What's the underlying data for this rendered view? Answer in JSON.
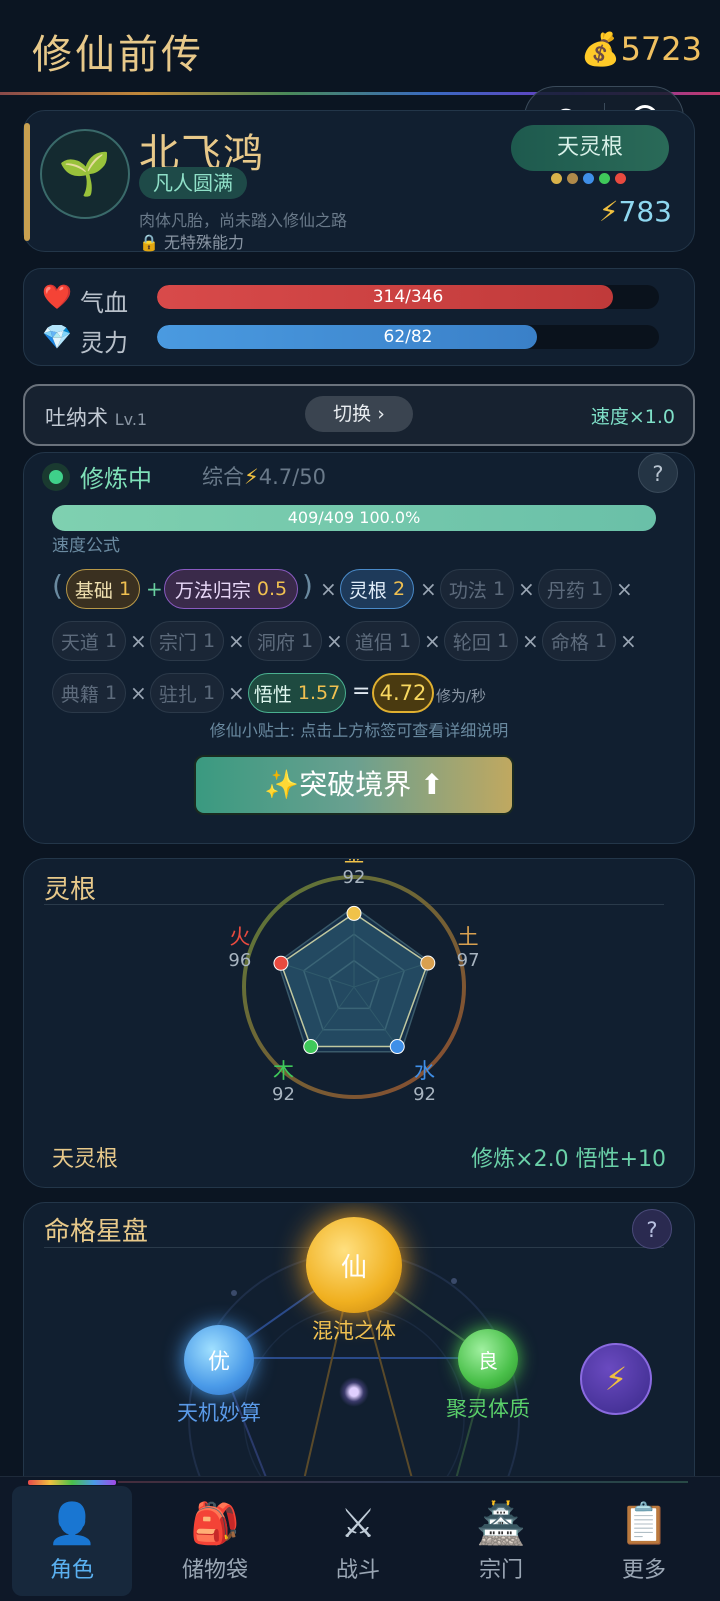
{
  "app": {
    "title": "修仙前传",
    "coins": "5723",
    "coin_icon": "money-bag-icon"
  },
  "profile": {
    "name": "北飞鸿",
    "realm": "凡人圆满",
    "desc": "肉体凡胎，尚未踏入修仙之路",
    "ability": "无特殊能力",
    "root_badge": "天灵根",
    "power": "783",
    "power_icon": "⚡",
    "root_dot_colors": [
      "#d8b24a",
      "#b08a4a",
      "#3f8fe8",
      "#3fc85a",
      "#e84a3f"
    ]
  },
  "stats": {
    "hp": {
      "label": "气血",
      "text": "314/346",
      "fraction": 0.908
    },
    "mp": {
      "label": "灵力",
      "text": "62/82",
      "fraction": 0.756
    }
  },
  "technique": {
    "name": "吐纳术",
    "level": "Lv.1",
    "switch_label": "切换 ›",
    "speed": "速度×1.0"
  },
  "cultivation": {
    "status": "修炼中",
    "summary_prefix": "综合",
    "summary_icon": "⚡",
    "summary_value": "4.7/50",
    "help": "?",
    "progress_text": "409/409  100.0%",
    "progress_fraction": 1.0,
    "formula_label": "速度公式",
    "tip": "修仙小贴士: 点击上方标签可查看详细说明",
    "breakthrough": "✨突破境界 ⬆",
    "rate_unit": "修为/秒",
    "terms": {
      "base": {
        "label": "基础",
        "value": "1"
      },
      "wanfa": {
        "label": "万法归宗",
        "value": "0.5"
      },
      "linggen": {
        "label": "灵根",
        "value": "2"
      },
      "gongfa": {
        "label": "功法",
        "value": "1"
      },
      "danyao": {
        "label": "丹药",
        "value": "1"
      },
      "tiandao": {
        "label": "天道",
        "value": "1"
      },
      "zongmen": {
        "label": "宗门",
        "value": "1"
      },
      "dongfu": {
        "label": "洞府",
        "value": "1"
      },
      "daolv": {
        "label": "道侣",
        "value": "1"
      },
      "lunhui": {
        "label": "轮回",
        "value": "1"
      },
      "mingge": {
        "label": "命格",
        "value": "1"
      },
      "dianji": {
        "label": "典籍",
        "value": "1"
      },
      "zhuzha": {
        "label": "驻扎",
        "value": "1"
      },
      "wuxing": {
        "label": "悟性",
        "value": "1.57"
      },
      "result": "4.72"
    }
  },
  "spirit_root": {
    "title": "灵根",
    "type": "天灵根",
    "bonus": "修炼×2.0  悟性+10",
    "elements": [
      {
        "name": "金",
        "value": "92",
        "color": "#f0c24a"
      },
      {
        "name": "土",
        "value": "97",
        "color": "#d8a050"
      },
      {
        "name": "水",
        "value": "92",
        "color": "#3f8fe8"
      },
      {
        "name": "木",
        "value": "92",
        "color": "#3fc85a"
      },
      {
        "name": "火",
        "value": "96",
        "color": "#e84a3f"
      }
    ]
  },
  "destiny": {
    "title": "命格星盘",
    "help": "?",
    "nodes": [
      {
        "glyph": "仙",
        "name": "混沌之体"
      },
      {
        "glyph": "优",
        "name": "天机妙算"
      },
      {
        "glyph": "良",
        "name": "聚灵体质"
      }
    ],
    "action_icon": "⚡"
  },
  "nav": [
    {
      "label": "角色",
      "icon": "👤"
    },
    {
      "label": "储物袋",
      "icon": "🎒"
    },
    {
      "label": "战斗",
      "icon": "⚔"
    },
    {
      "label": "宗门",
      "icon": "🏯"
    },
    {
      "label": "更多",
      "icon": "📋"
    }
  ]
}
